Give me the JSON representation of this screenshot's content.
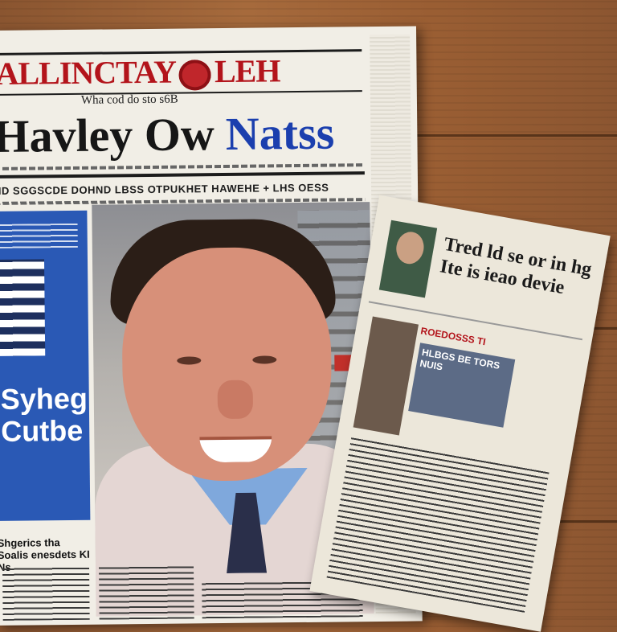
{
  "newspaper": {
    "masthead_left": "ALLINCTAY",
    "masthead_right": "LEH",
    "subline": "Wha cod do sto s6B",
    "headline_dark": "Havley Ow",
    "headline_blue": "Natss",
    "deck": "HD SGGSCDE DOHND  LBSS  OTPUKHET HAWEHE + LHS OESS",
    "sidebar_text": "Syheg Cutbe",
    "kicker": "Shgerics tha Soalis enesdets KI Ns"
  },
  "clipping": {
    "headline": "Tred ld se or in hg Ite is ieao devie",
    "subhead": "ROEDOSSS TI",
    "box_text": "HLBGS BE TORS NUIS"
  },
  "colors": {
    "masthead_red": "#b3141b",
    "headline_blue": "#1b3fae",
    "sidebar_blue": "#2a59b5",
    "wood": "#9a5e33"
  }
}
